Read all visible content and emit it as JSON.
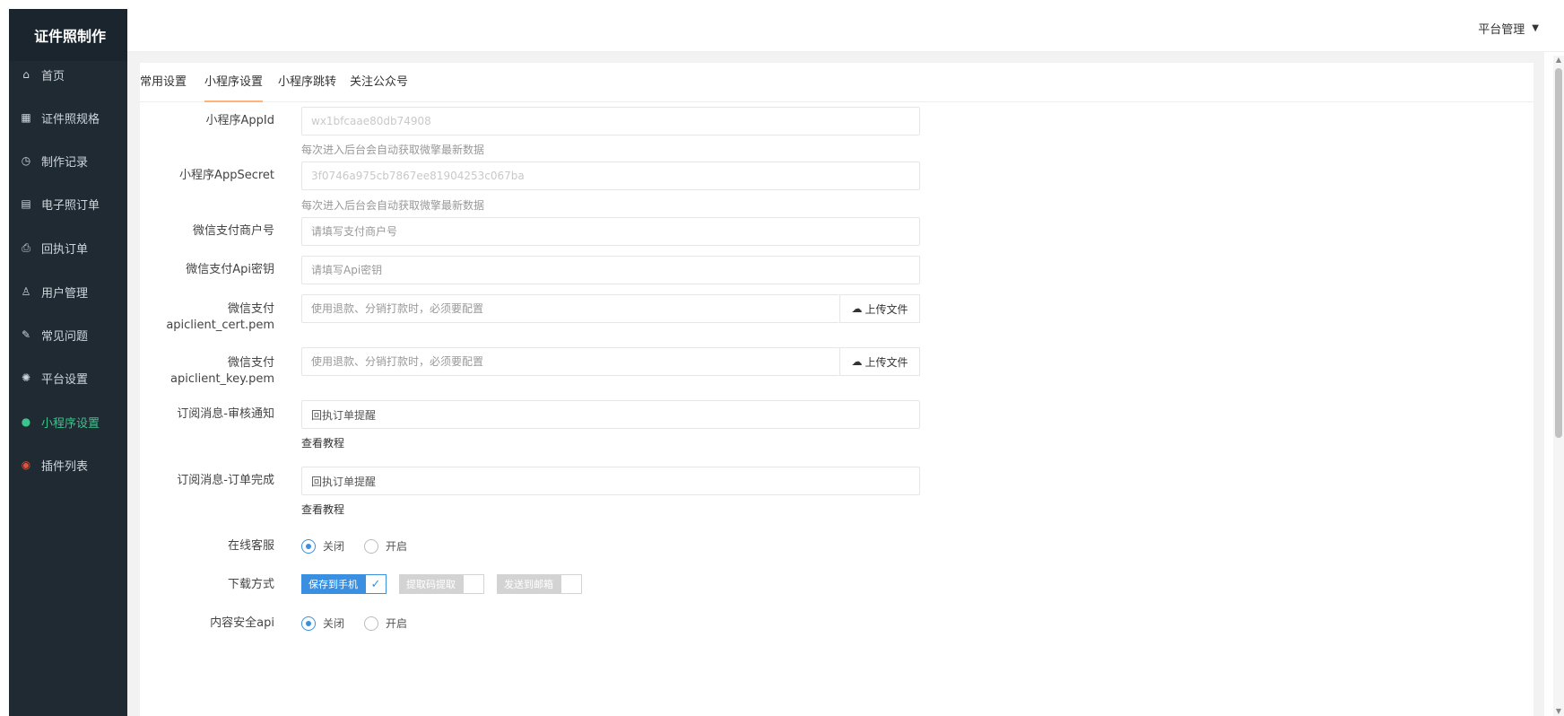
{
  "app": {
    "logo": "证件照制作"
  },
  "header": {
    "user_menu": "平台管理",
    "caret": "▼"
  },
  "sidebar": {
    "items": [
      {
        "icon": "home-icon",
        "label": "首页"
      },
      {
        "icon": "id-spec-icon",
        "label": "证件照规格"
      },
      {
        "icon": "clock-icon",
        "label": "制作记录"
      },
      {
        "icon": "grid-icon",
        "label": "电子照订单"
      },
      {
        "icon": "print-icon",
        "label": "回执订单"
      },
      {
        "icon": "user-icon",
        "label": "用户管理"
      },
      {
        "icon": "faq-icon",
        "label": "常见问题"
      },
      {
        "icon": "gear-icon",
        "label": "平台设置"
      },
      {
        "icon": "miniprogram-icon",
        "label": "小程序设置"
      },
      {
        "icon": "plugin-icon",
        "label": "插件列表"
      }
    ]
  },
  "tabs": [
    {
      "label": "常用设置"
    },
    {
      "label": "小程序设置"
    },
    {
      "label": "小程序跳转"
    },
    {
      "label": "关注公众号"
    }
  ],
  "form": {
    "appid": {
      "label": "小程序AppId",
      "value": "wx1bfcaae80db74908",
      "help": "每次进入后台会自动获取微擎最新数据"
    },
    "appsecret": {
      "label": "小程序AppSecret",
      "value": "3f0746a975cb7867ee81904253c067ba",
      "help": "每次进入后台会自动获取微擎最新数据"
    },
    "mchid": {
      "label": "微信支付商户号",
      "placeholder": "请填写支付商户号"
    },
    "apikey": {
      "label": "微信支付Api密钥",
      "placeholder": "请填写Api密钥"
    },
    "cert": {
      "label_line1": "微信支付",
      "label_line2": "apiclient_cert.pem",
      "placeholder": "使用退款、分销打款时，必须要配置",
      "upload": "上传文件"
    },
    "key": {
      "label_line1": "微信支付",
      "label_line2": "apiclient_key.pem",
      "placeholder": "使用退款、分销打款时，必须要配置",
      "upload": "上传文件"
    },
    "sub_review": {
      "label": "订阅消息-审核通知",
      "value": "回执订单提醒",
      "link": "查看教程"
    },
    "sub_done": {
      "label": "订阅消息-订单完成",
      "value": "回执订单提醒",
      "link": "查看教程"
    },
    "online_service": {
      "label": "在线客服",
      "options": [
        "关闭",
        "开启"
      ],
      "selected": "关闭"
    },
    "download": {
      "label": "下载方式",
      "options": [
        "保存到手机",
        "提取码提取",
        "发送到邮箱"
      ],
      "checked": [
        "保存到手机"
      ]
    },
    "content_security": {
      "label": "内容安全api",
      "options": [
        "关闭",
        "开启"
      ],
      "selected": "关闭"
    }
  }
}
